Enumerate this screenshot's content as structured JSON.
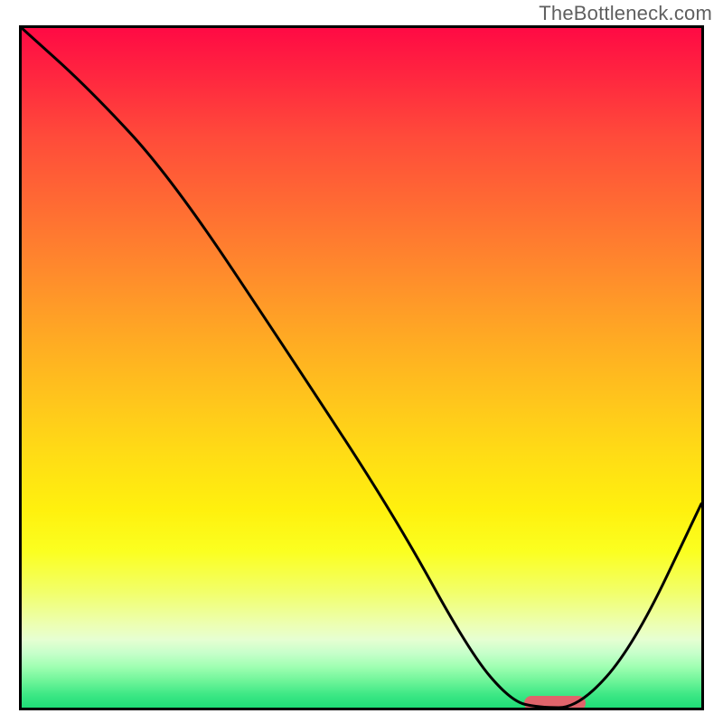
{
  "watermark": "TheBottleneck.com",
  "colors": {
    "frame_border": "#000000",
    "curve_stroke": "#000000",
    "marker_fill": "#e0646b"
  },
  "chart_data": {
    "type": "line",
    "title": "",
    "xlabel": "",
    "ylabel": "",
    "xlim": [
      0,
      100
    ],
    "ylim": [
      0,
      100
    ],
    "grid": false,
    "legend": false,
    "series": [
      {
        "name": "bottleneck-curve",
        "x": [
          0,
          10,
          22,
          40,
          55,
          66,
          72,
          76,
          82,
          90,
          100
        ],
        "values": [
          100,
          91,
          78,
          51,
          28,
          8,
          1,
          0,
          0,
          9,
          30
        ]
      }
    ],
    "annotations": [
      {
        "name": "optimal-marker",
        "shape": "pill",
        "x_start": 74,
        "x_end": 83,
        "y": 0.7,
        "color": "#e0646b"
      }
    ],
    "background": {
      "type": "vertical-gradient",
      "stops": [
        {
          "pos": 0.0,
          "color": "#ff0a44"
        },
        {
          "pos": 0.5,
          "color": "#ffb820"
        },
        {
          "pos": 0.78,
          "color": "#faff30"
        },
        {
          "pos": 0.9,
          "color": "#e6ffd2"
        },
        {
          "pos": 1.0,
          "color": "#1edc76"
        }
      ]
    }
  }
}
